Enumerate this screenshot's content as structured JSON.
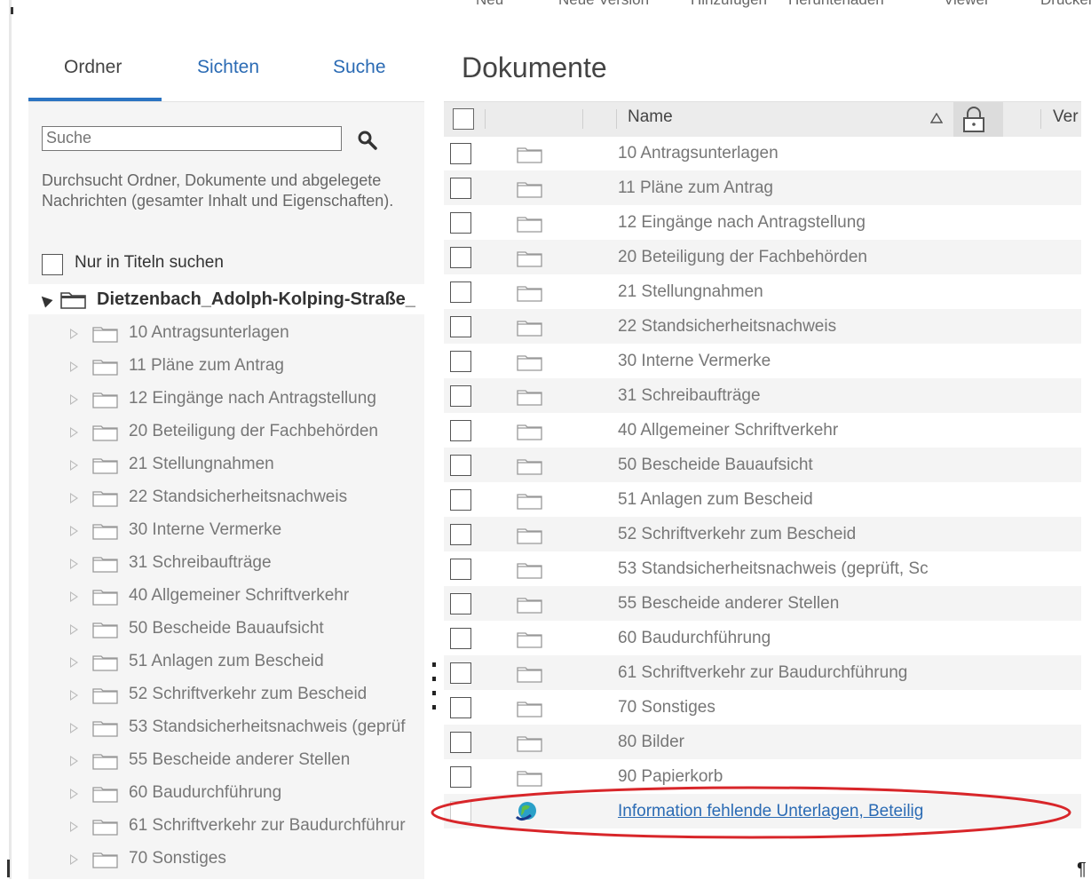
{
  "toolbar": {
    "items": [
      "Neu",
      "Neue Version",
      "Hinzufügen",
      "Herunterladen",
      "Viewer",
      "Drucken"
    ]
  },
  "left_panel": {
    "tabs": [
      {
        "label": "Ordner",
        "active": true
      },
      {
        "label": "Sichten",
        "active": false
      },
      {
        "label": "Suche",
        "active": false
      }
    ],
    "search": {
      "placeholder": "Suche",
      "help_text": "Durchsucht Ordner, Dokumente und abgelegete Nachrichten (gesamter Inhalt und Eigenschaften).",
      "title_only_label": "Nur in Titeln suchen"
    },
    "tree": {
      "root_label": "Dietzenbach_Adolph-Kolping-Straße_",
      "items": [
        "10 Antragsunterlagen",
        "11 Pläne zum Antrag",
        "12 Eingänge nach Antragstellung",
        "20 Beteiligung der Fachbehörden",
        "21 Stellungnahmen",
        "22 Standsicherheitsnachweis",
        "30 Interne Vermerke",
        "31 Schreibaufträge",
        "40 Allgemeiner Schriftverkehr",
        "50 Bescheide Bauaufsicht",
        "51 Anlagen zum Bescheid",
        "52 Schriftverkehr zum Bescheid",
        "53 Standsicherheitsnachweis (geprüf",
        "55 Bescheide anderer Stellen",
        "60 Baudurchführung",
        "61 Schriftverkehr zur Baudurchführur",
        "70 Sonstiges"
      ]
    }
  },
  "right_panel": {
    "title": "Dokumente",
    "columns": {
      "name": "Name",
      "version": "Ver"
    },
    "rows": [
      {
        "name": "10 Antragsunterlagen",
        "type": "folder"
      },
      {
        "name": "11 Pläne zum Antrag",
        "type": "folder"
      },
      {
        "name": "12 Eingänge nach Antragstellung",
        "type": "folder"
      },
      {
        "name": "20 Beteiligung der Fachbehörden",
        "type": "folder"
      },
      {
        "name": "21 Stellungnahmen",
        "type": "folder"
      },
      {
        "name": "22 Standsicherheitsnachweis",
        "type": "folder"
      },
      {
        "name": "30 Interne Vermerke",
        "type": "folder"
      },
      {
        "name": "31 Schreibaufträge",
        "type": "folder"
      },
      {
        "name": "40 Allgemeiner Schriftverkehr",
        "type": "folder"
      },
      {
        "name": "50 Bescheide Bauaufsicht",
        "type": "folder"
      },
      {
        "name": "51 Anlagen zum Bescheid",
        "type": "folder"
      },
      {
        "name": "52 Schriftverkehr zum Bescheid",
        "type": "folder"
      },
      {
        "name": "53 Standsicherheitsnachweis (geprüft, Sc",
        "type": "folder"
      },
      {
        "name": "55 Bescheide anderer Stellen",
        "type": "folder"
      },
      {
        "name": "60 Baudurchführung",
        "type": "folder"
      },
      {
        "name": "61 Schriftverkehr zur Baudurchführung",
        "type": "folder"
      },
      {
        "name": "70 Sonstiges",
        "type": "folder"
      },
      {
        "name": "80 Bilder",
        "type": "folder"
      },
      {
        "name": "90 Papierkorb",
        "type": "folder"
      },
      {
        "name": "Information fehlende Unterlagen, Beteilig",
        "type": "document"
      }
    ]
  },
  "colors": {
    "accent": "#2b74c2",
    "link": "#2b6bb4",
    "highlight": "#d8262a"
  }
}
